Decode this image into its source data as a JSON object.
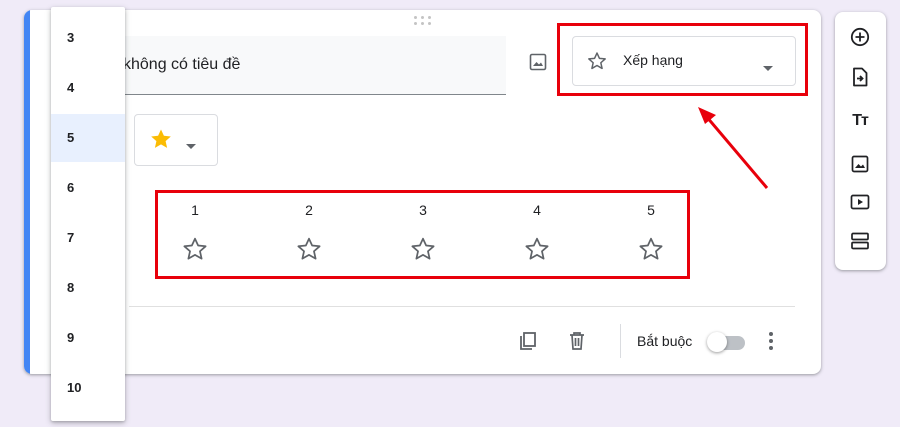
{
  "question": {
    "title_text": "không có tiêu đề",
    "type_label": "Xếp hạng",
    "type_icon": "star-outline-icon",
    "rating_icon": "star-filled-icon",
    "rating_icon_color": "#fbbc04",
    "accent_color": "#4285f4"
  },
  "scale_dropdown": {
    "options": [
      "3",
      "4",
      "5",
      "6",
      "7",
      "8",
      "9",
      "10"
    ],
    "selected": "5"
  },
  "scale": {
    "labels": [
      "1",
      "2",
      "3",
      "4",
      "5"
    ]
  },
  "footer": {
    "required_label": "Bắt buộc",
    "required_on": false
  },
  "toolbar": {
    "items": [
      "add-question-icon",
      "import-questions-icon",
      "add-title-icon",
      "add-image-icon",
      "add-video-icon",
      "add-section-icon"
    ]
  },
  "annotation": {
    "highlight_color": "#e8000b"
  }
}
